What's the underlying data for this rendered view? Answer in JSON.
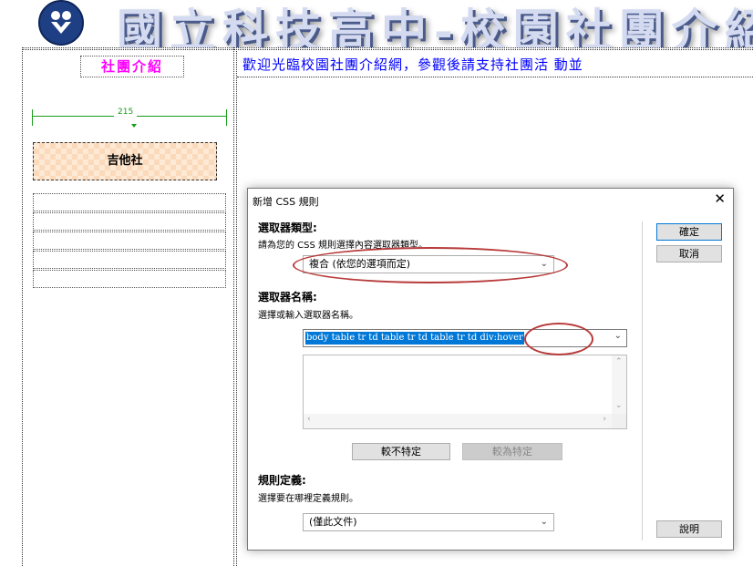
{
  "page": {
    "banner_title": "國立科技高中-校園社團介紹",
    "left_title": "社團介紹",
    "marquee_text": "歡迎光臨校園社團介紹網，參觀後請支持社團活 動並",
    "width_ruler_value": "215",
    "club_cell": "吉他社"
  },
  "dialog": {
    "title": "新增 CSS 規則",
    "close_symbol": "✕",
    "selector_type": {
      "heading": "選取器類型:",
      "description": "請為您的 CSS 規則選擇內容選取器類型。",
      "selected_value": "複合 (依您的選項而定)"
    },
    "selector_name": {
      "heading": "選取器名稱:",
      "description": "選擇或輸入選取器名稱。",
      "value": "body table tr td table tr td table tr td div:hover"
    },
    "less_specific_label": "較不特定",
    "more_specific_label": "較為特定",
    "rule_definition": {
      "heading": "規則定義:",
      "description": "選擇要在哪裡定義規則。",
      "selected_value": "(僅此文件)"
    },
    "ok_label": "確定",
    "cancel_label": "取消",
    "help_label": "說明"
  },
  "icons": {
    "dropdown": "chevron-down-icon",
    "scroll_up": "chevron-up-icon",
    "scroll_down": "chevron-down-icon",
    "scroll_left": "chevron-left-icon",
    "scroll_right": "chevron-right-icon",
    "close": "close-icon"
  },
  "colors": {
    "selection": "#0078d7",
    "annotation": "#b83a3a",
    "left_title": "#ff00ff",
    "marquee": "#0000ff",
    "ruler": "#1a9c1a"
  }
}
